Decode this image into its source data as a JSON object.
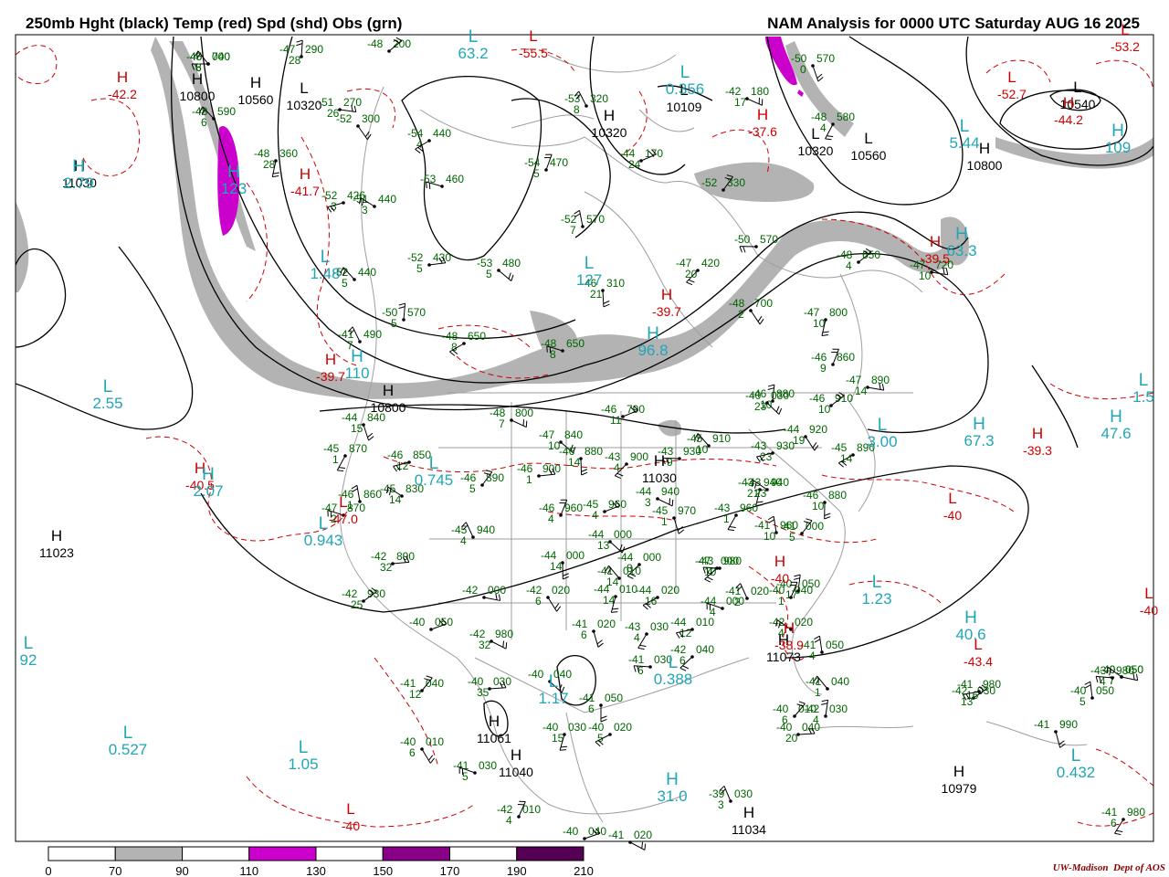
{
  "header": {
    "title_left": "250mb Hght (black) Temp (red) Spd (shd) Obs (grn)",
    "title_right": "NAM Analysis for 0000 UTC Saturday  AUG 16 2025"
  },
  "colorbar": {
    "ticks": [
      "0",
      "70",
      "90",
      "110",
      "130",
      "150",
      "170",
      "190",
      "210"
    ],
    "fills": [
      "#ffffff",
      "#b3b3b3",
      "#ffffff",
      "#cc00cc",
      "#ffffff",
      "#880088",
      "#ffffff",
      "#550055"
    ]
  },
  "credit": {
    "left": "UW-Madison",
    "right": "Dept of AOS"
  },
  "colors": {
    "height": "#000000",
    "temp": "#cc0000",
    "speed_label": "#22a5b5",
    "obs": "#006600",
    "speed_shade": "#b3b3b3",
    "jet_core": "#cc00cc"
  },
  "height_labels": [
    {
      "text": "10800"
    },
    {
      "text": "10560"
    },
    {
      "text": "10320"
    },
    {
      "text": "11030"
    },
    {
      "text": "10320"
    },
    {
      "text": "10109"
    },
    {
      "text": "10320"
    },
    {
      "text": "10560"
    },
    {
      "text": "10800"
    },
    {
      "text": "10540"
    },
    {
      "text": "10800"
    },
    {
      "text": "11030"
    },
    {
      "text": "11023"
    },
    {
      "text": "11073"
    },
    {
      "text": "11061"
    },
    {
      "text": "11040"
    },
    {
      "text": "11034"
    },
    {
      "text": "10979"
    }
  ],
  "temp_labels": [
    {
      "text": "-42.2"
    },
    {
      "text": "-55.5"
    },
    {
      "text": "-37.6"
    },
    {
      "text": "-52.7"
    },
    {
      "text": "-44.2"
    },
    {
      "text": "-53.2"
    },
    {
      "text": "-41.7"
    },
    {
      "text": "-39.7"
    },
    {
      "text": "-39.7"
    },
    {
      "text": "-39.5"
    },
    {
      "text": "-40.5"
    },
    {
      "text": "-47.0"
    },
    {
      "text": "-39.3"
    },
    {
      "text": "-38.9"
    },
    {
      "text": "-43.4"
    },
    {
      "text": "-40"
    },
    {
      "text": "-40"
    },
    {
      "text": "-40"
    },
    {
      "text": "-40"
    }
  ],
  "speed_labels": [
    {
      "text": "63.2"
    },
    {
      "text": "0.356"
    },
    {
      "text": "2.79"
    },
    {
      "text": "123"
    },
    {
      "text": "5.44"
    },
    {
      "text": "109"
    },
    {
      "text": "1.48"
    },
    {
      "text": "127"
    },
    {
      "text": "96.8"
    },
    {
      "text": "110"
    },
    {
      "text": "2.55"
    },
    {
      "text": "2.07"
    },
    {
      "text": "0.745"
    },
    {
      "text": "0.943"
    },
    {
      "text": "3.00"
    },
    {
      "text": "67.3"
    },
    {
      "text": "47.6"
    },
    {
      "text": "1.23"
    },
    {
      "text": "40.6"
    },
    {
      "text": "1.17"
    },
    {
      "text": "0.388"
    },
    {
      "text": "92"
    },
    {
      "text": "0.527"
    },
    {
      "text": "1.05"
    },
    {
      "text": "31.0"
    },
    {
      "text": "0.432"
    },
    {
      "text": "63.3"
    },
    {
      "text": "1.5"
    }
  ],
  "obs": [
    {
      "t": "-45",
      "h": "700",
      "dp": "8"
    },
    {
      "t": "-48",
      "h": "590",
      "dp": "6"
    },
    {
      "t": "-47",
      "h": "290",
      "dp": "28"
    },
    {
      "t": "-48",
      "h": "200",
      "dp": ""
    },
    {
      "t": "-51",
      "h": "270",
      "dp": "26"
    },
    {
      "t": "-52",
      "h": "300",
      "dp": ""
    },
    {
      "t": "-48",
      "h": "360",
      "dp": "28"
    },
    {
      "t": "-54",
      "h": "440",
      "dp": "4"
    },
    {
      "t": "-53",
      "h": "460",
      "dp": ""
    },
    {
      "t": "-53",
      "h": "320",
      "dp": "8"
    },
    {
      "t": "-54",
      "h": "470",
      "dp": "5"
    },
    {
      "t": "-44",
      "h": "170",
      "dp": "24"
    },
    {
      "t": "-42",
      "h": "180",
      "dp": "17"
    },
    {
      "t": "-50",
      "h": "570",
      "dp": "0"
    },
    {
      "t": "-48",
      "h": "580",
      "dp": "4"
    },
    {
      "t": "-52",
      "h": "426",
      "dp": "3"
    },
    {
      "t": "-51",
      "h": "440",
      "dp": "3"
    },
    {
      "t": "-52",
      "h": "570",
      "dp": "7"
    },
    {
      "t": "-52",
      "h": "330",
      "dp": ""
    },
    {
      "t": "-52",
      "h": "430",
      "dp": "5"
    },
    {
      "t": "-53",
      "h": "480",
      "dp": "5"
    },
    {
      "t": "-46",
      "h": "310",
      "dp": "21"
    },
    {
      "t": "-47",
      "h": "420",
      "dp": "20"
    },
    {
      "t": "-50",
      "h": "570",
      "dp": ""
    },
    {
      "t": "-52",
      "h": "440",
      "dp": "5"
    },
    {
      "t": "-50",
      "h": "570",
      "dp": "5"
    },
    {
      "t": "-48",
      "h": "650",
      "dp": "4"
    },
    {
      "t": "-47",
      "h": "720",
      "dp": "10"
    },
    {
      "t": "-48",
      "h": "700",
      "dp": "2"
    },
    {
      "t": "-47",
      "h": "800",
      "dp": "10"
    },
    {
      "t": "-48",
      "h": "650",
      "dp": "8"
    },
    {
      "t": "-48",
      "h": "650",
      "dp": "8"
    },
    {
      "t": "-41",
      "h": "490",
      "dp": "7"
    },
    {
      "t": "-46",
      "h": "860",
      "dp": "9"
    },
    {
      "t": "-46",
      "h": "790",
      "dp": "11"
    },
    {
      "t": "-48",
      "h": "800",
      "dp": "7"
    },
    {
      "t": "-44",
      "h": "840",
      "dp": "15"
    },
    {
      "t": "-45",
      "h": "870",
      "dp": "1"
    },
    {
      "t": "-46",
      "h": "850",
      "dp": "12"
    },
    {
      "t": "-45",
      "h": "830",
      "dp": "14"
    },
    {
      "t": "-46",
      "h": "860",
      "dp": "1"
    },
    {
      "t": "-46",
      "h": "890",
      "dp": "5"
    },
    {
      "t": "-46",
      "h": "900",
      "dp": "1"
    },
    {
      "t": "-47",
      "h": "840",
      "dp": "10"
    },
    {
      "t": "-46",
      "h": "880",
      "dp": "14"
    },
    {
      "t": "-43",
      "h": "900",
      "dp": "4"
    },
    {
      "t": "-43",
      "h": "930",
      "dp": "9"
    },
    {
      "t": "-45",
      "h": "910",
      "dp": "10"
    },
    {
      "t": "-46",
      "h": "880",
      "dp": "10"
    },
    {
      "t": "-46",
      "h": "910",
      "dp": "10"
    },
    {
      "t": "-47",
      "h": "890",
      "dp": "14"
    },
    {
      "t": "-44",
      "h": "920",
      "dp": "19"
    },
    {
      "t": "-43",
      "h": "940",
      "dp": "21"
    },
    {
      "t": "-45",
      "h": "890",
      "dp": "14"
    },
    {
      "t": "-47",
      "h": "870",
      "dp": "2"
    },
    {
      "t": "-45",
      "h": "940",
      "dp": "4"
    },
    {
      "t": "-46",
      "h": "960",
      "dp": "4"
    },
    {
      "t": "-45",
      "h": "960",
      "dp": "4"
    },
    {
      "t": "-44",
      "h": "940",
      "dp": "3"
    },
    {
      "t": "-45",
      "h": "970",
      "dp": "1"
    },
    {
      "t": "-43",
      "h": "960",
      "dp": "1"
    },
    {
      "t": "-43",
      "h": "930",
      "dp": "23"
    },
    {
      "t": "-43",
      "h": "940",
      "dp": "23"
    },
    {
      "t": "-41",
      "h": "960",
      "dp": "10"
    },
    {
      "t": "-41",
      "h": "000",
      "dp": "5"
    },
    {
      "t": "-42",
      "h": "890",
      "dp": "32"
    },
    {
      "t": "-44",
      "h": "000",
      "dp": "13"
    },
    {
      "t": "-44",
      "h": "000",
      "dp": "14"
    },
    {
      "t": "-44",
      "h": "000",
      "dp": "8"
    },
    {
      "t": "-43",
      "h": "980",
      "dp": "4"
    },
    {
      "t": "-41",
      "h": "010",
      "dp": "14"
    },
    {
      "t": "-40",
      "h": "050",
      "dp": "17"
    },
    {
      "t": "-42",
      "h": "930",
      "dp": "25"
    },
    {
      "t": "-42",
      "h": "000",
      "dp": ""
    },
    {
      "t": "-42",
      "h": "020",
      "dp": "6"
    },
    {
      "t": "-44",
      "h": "010",
      "dp": "14"
    },
    {
      "t": "-44",
      "h": "020",
      "dp": "16"
    },
    {
      "t": "-44",
      "h": "000",
      "dp": "4"
    },
    {
      "t": "-41",
      "h": "020",
      "dp": "2"
    },
    {
      "t": "-40",
      "h": "040",
      "dp": "1"
    },
    {
      "t": "-40",
      "h": "050",
      "dp": ""
    },
    {
      "t": "-42",
      "h": "980",
      "dp": "32"
    },
    {
      "t": "-41",
      "h": "020",
      "dp": "6"
    },
    {
      "t": "-43",
      "h": "030",
      "dp": "4"
    },
    {
      "t": "-44",
      "h": "010",
      "dp": "12"
    },
    {
      "t": "-42",
      "h": "020",
      "dp": "4"
    },
    {
      "t": "-41",
      "h": "050",
      "dp": "4"
    },
    {
      "t": "-41",
      "h": "040",
      "dp": "12"
    },
    {
      "t": "-40",
      "h": "030",
      "dp": "35"
    },
    {
      "t": "-40",
      "h": "040",
      "dp": ""
    },
    {
      "t": "-41",
      "h": "050",
      "dp": "6"
    },
    {
      "t": "-42",
      "h": "040",
      "dp": "6"
    },
    {
      "t": "-41",
      "h": "030",
      "dp": "6"
    },
    {
      "t": "-41",
      "h": "040",
      "dp": "1"
    },
    {
      "t": "-42",
      "h": "030",
      "dp": "4"
    },
    {
      "t": "-42",
      "h": "030",
      "dp": "13"
    },
    {
      "t": "-40",
      "h": "050",
      "dp": "7"
    },
    {
      "t": "-40",
      "h": "010",
      "dp": "6"
    },
    {
      "t": "-40",
      "h": "030",
      "dp": "15"
    },
    {
      "t": "-40",
      "h": "020",
      "dp": "5"
    },
    {
      "t": "-41",
      "h": "030",
      "dp": "5"
    },
    {
      "t": "-39",
      "h": "030",
      "dp": "3"
    },
    {
      "t": "-42",
      "h": "010",
      "dp": "4"
    },
    {
      "t": "-40",
      "h": "040",
      "dp": ""
    },
    {
      "t": "-41",
      "h": "020",
      "dp": ""
    },
    {
      "t": "-41",
      "h": "990",
      "dp": ""
    },
    {
      "t": "-41",
      "h": "980",
      "dp": "6"
    },
    {
      "t": "-41",
      "h": "980",
      "dp": "16"
    },
    {
      "t": "-40",
      "h": "050",
      "dp": "7"
    },
    {
      "t": "-40",
      "h": "050",
      "dp": "5"
    },
    {
      "t": "-40",
      "h": "010",
      "dp": "6"
    },
    {
      "t": "-40",
      "h": "040",
      "dp": "20"
    },
    {
      "t": "-40",
      "h": "030",
      "dp": "23"
    },
    {
      "t": "-46",
      "h": "880",
      "dp": "10"
    },
    {
      "t": "-47",
      "h": "000",
      "dp": "10"
    },
    {
      "t": "-43",
      "h": "980",
      "dp": "4"
    },
    {
      "t": "-40",
      "h": "040",
      "dp": "6"
    }
  ]
}
